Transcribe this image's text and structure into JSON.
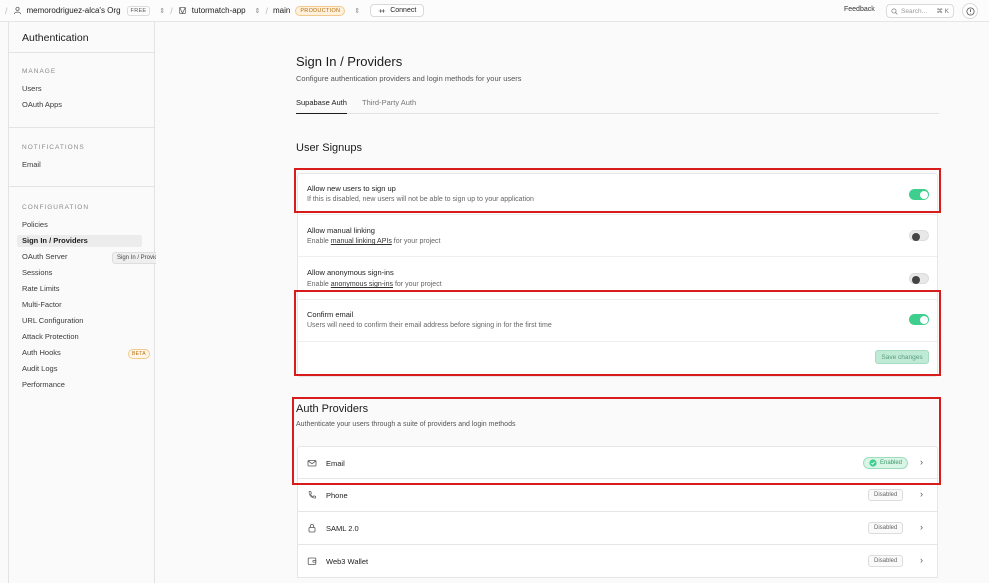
{
  "topbar": {
    "org": "memorodriguez-alca's Org",
    "org_plan": "FREE",
    "project": "tutormatch-app",
    "branch": "main",
    "branch_env": "PRODUCTION",
    "connect": "Connect",
    "feedback": "Feedback",
    "search_placeholder": "Search...",
    "search_shortcut": "⌘ K"
  },
  "sidebar": {
    "title": "Authentication",
    "sections": [
      {
        "label": "MANAGE",
        "items": [
          "Users",
          "OAuth Apps"
        ]
      },
      {
        "label": "NOTIFICATIONS",
        "items": [
          "Email"
        ]
      },
      {
        "label": "CONFIGURATION",
        "items": [
          "Policies",
          "Sign In / Providers",
          "OAuth Server",
          "Sessions",
          "Rate Limits",
          "Multi-Factor",
          "URL Configuration",
          "Attack Protection",
          "Auth Hooks",
          "Audit Logs",
          "Performance"
        ]
      }
    ],
    "active_item": "Sign In / Providers",
    "beta_badge": "BETA",
    "tooltip": "Sign In / Providers"
  },
  "page": {
    "title": "Sign In / Providers",
    "subtitle": "Configure authentication providers and login methods for your users",
    "tabs": [
      "Supabase Auth",
      "Third-Party Auth"
    ],
    "active_tab": "Supabase Auth"
  },
  "user_signups": {
    "title": "User Signups",
    "allow_signup": {
      "title": "Allow new users to sign up",
      "desc": "If this is disabled, new users will not be able to sign up to your application",
      "enabled": true
    },
    "manual_linking": {
      "title": "Allow manual linking",
      "desc_pre": "Enable ",
      "desc_link": "manual linking APIs",
      "desc_post": " for your project",
      "enabled": false
    },
    "anonymous": {
      "title": "Allow anonymous sign-ins",
      "desc_pre": "Enable ",
      "desc_link": "anonymous sign-ins",
      "desc_post": " for your project",
      "enabled": false
    },
    "confirm_email": {
      "title": "Confirm email",
      "desc": "Users will need to confirm their email address before signing in for the first time",
      "enabled": true
    },
    "save": "Save changes"
  },
  "auth_providers": {
    "title": "Auth Providers",
    "subtitle": "Authenticate your users through a suite of providers and login methods",
    "providers": [
      {
        "name": "Email",
        "status": "Enabled",
        "icon": "mail-icon"
      },
      {
        "name": "Phone",
        "status": "Disabled",
        "icon": "phone-icon"
      },
      {
        "name": "SAML 2.0",
        "status": "Disabled",
        "icon": "lock-icon"
      },
      {
        "name": "Web3 Wallet",
        "status": "Disabled",
        "icon": "wallet-icon"
      }
    ]
  },
  "colors": {
    "accent": "#3ecf8e",
    "highlight": "#d81b1b"
  }
}
